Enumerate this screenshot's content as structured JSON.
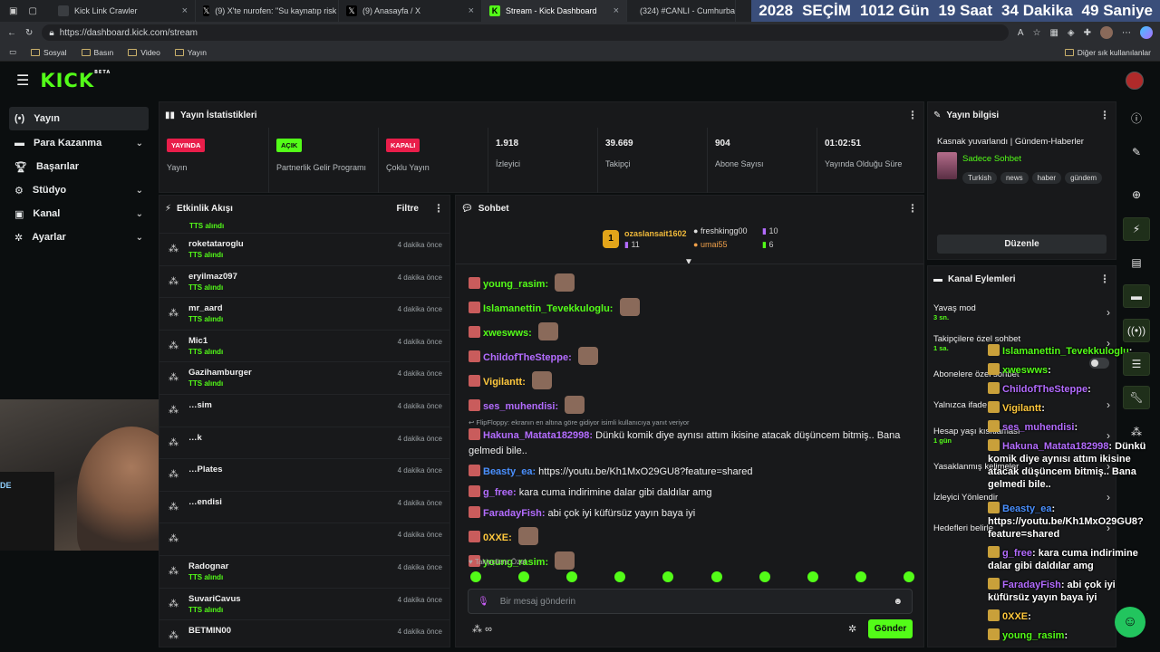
{
  "browser": {
    "tabs": [
      {
        "title": "Kick Link Crawler",
        "icon_color": "#3a3d41"
      },
      {
        "title": "(9) X'te nurofen: \"Su kaynatıp risk",
        "icon_color": "#000000"
      },
      {
        "title": "(9) Anasayfa / X",
        "icon_color": "#000000"
      },
      {
        "title": "Stream - Kick Dashboard",
        "icon_color": "#53fc18"
      },
      {
        "title": "(324) #CANLI - Cumhurbaşk",
        "icon_color": "#ff0000"
      }
    ],
    "url": "https://dashboard.kick.com/stream",
    "bookmarks": [
      "Sosyal",
      "Basın",
      "Video",
      "Yayın"
    ],
    "other_bookmarks": "Diğer sık kullanılanlar"
  },
  "countdown": {
    "year": "2028",
    "label": "SEÇİM",
    "days": "1012",
    "days_label": "Gün",
    "hours": "19",
    "hours_label": "Saat",
    "minutes": "34",
    "minutes_label": "Dakika",
    "seconds": "49",
    "seconds_label": "Saniye"
  },
  "brand": {
    "logo": "KICK",
    "beta": "BETA",
    "color": "#53fc18"
  },
  "sidebar": {
    "items": [
      {
        "label": "Yayın",
        "icon": "broadcast-icon",
        "active": true
      },
      {
        "label": "Para Kazanma",
        "icon": "money-icon"
      },
      {
        "label": "Başarılar",
        "icon": "trophy-icon"
      },
      {
        "label": "Stüdyo",
        "icon": "studio-icon"
      },
      {
        "label": "Kanal",
        "icon": "channel-icon"
      },
      {
        "label": "Ayarlar",
        "icon": "gear-icon"
      }
    ]
  },
  "stats": {
    "title": "Yayın İstatistikleri",
    "cards": [
      {
        "badge": "YAYINDA",
        "label": "Yayın",
        "badge_color": "#e91e4a"
      },
      {
        "badge": "AÇIK",
        "label": "Partnerlik Gelir Programı",
        "badge_color": "#53fc18"
      },
      {
        "badge": "KAPALI",
        "label": "Çoklu Yayın",
        "badge_color": "#e91e4a"
      },
      {
        "value": "1.918",
        "label": "İzleyici"
      },
      {
        "value": "39.669",
        "label": "Takipçi"
      },
      {
        "value": "904",
        "label": "Abone Sayısı"
      },
      {
        "value": "01:02:51",
        "label": "Yayında Olduğu Süre"
      }
    ]
  },
  "activity": {
    "title": "Etkinlik Akışı",
    "filter": "Filtre",
    "top_partial": "TTS alındı",
    "events": [
      {
        "name": "roketataroglu",
        "sub": "TTS alındı",
        "time": "4 dakika önce"
      },
      {
        "name": "eryilmaz097",
        "sub": "TTS alındı",
        "time": "4 dakika önce"
      },
      {
        "name": "mr_aard",
        "sub": "TTS alındı",
        "time": "4 dakika önce"
      },
      {
        "name": "Mic1",
        "sub": "TTS alındı",
        "time": "4 dakika önce"
      },
      {
        "name": "Gazihamburger",
        "sub": "TTS alındı",
        "time": "4 dakika önce"
      },
      {
        "name": "…sim",
        "sub": "",
        "time": "4 dakika önce"
      },
      {
        "name": "…k",
        "sub": "",
        "time": "4 dakika önce"
      },
      {
        "name": "…Plates",
        "sub": "",
        "time": "4 dakika önce"
      },
      {
        "name": "…endisi",
        "sub": "",
        "time": "4 dakika önce"
      },
      {
        "name": "",
        "sub": "",
        "time": "4 dakika önce"
      },
      {
        "name": "Radognar",
        "sub": "TTS alındı",
        "time": "4 dakika önce"
      },
      {
        "name": "SuvariCavus",
        "sub": "TTS alındı",
        "time": "4 dakika önce"
      },
      {
        "name": "BETMIN00",
        "sub": "",
        "time": "4 dakika önce"
      }
    ]
  },
  "chat": {
    "title": "Sohbet",
    "leaders": [
      {
        "rank": "1",
        "name": "ozaslansait1602",
        "count": "11"
      },
      {
        "name": "freshkingg00",
        "count": "10"
      },
      {
        "name": "umai55",
        "count": "6"
      }
    ],
    "messages": [
      {
        "user": "young_rasim",
        "color": "#53fc18",
        "text": ""
      },
      {
        "user": "Islamanettin_Tevekkuloglu",
        "color": "#53fc18",
        "text": ""
      },
      {
        "user": "xweswws",
        "color": "#53fc18",
        "text": ""
      },
      {
        "user": "ChildofTheSteppe",
        "color": "#b36cff",
        "text": ""
      },
      {
        "user": "Vigilantt",
        "color": "#ffc83d",
        "text": ""
      },
      {
        "user": "ses_muhendisi",
        "color": "#b36cff",
        "text": ""
      }
    ],
    "reply_note": "FlipFloppy: ekranın en altına göre gidiyor isimli kullanıcıya yanıt veriyor",
    "messages2": [
      {
        "user": "Hakuna_Matata182998",
        "color": "#b36cff",
        "text": "Dünkü komik diye aynısı attım ikisine atacak düşüncem bitmiş.. Bana gelmedi bile.."
      },
      {
        "user": "Beasty_ea",
        "color": "#4a90ff",
        "text": "https://youtu.be/Kh1MxO29GU8?feature=shared"
      },
      {
        "user": "g_free",
        "color": "#b36cff",
        "text": "kara cuma indirimine dalar gibi daldılar amg"
      },
      {
        "user": "FaradayFish",
        "color": "#b36cff",
        "text": "abi çok iyi küfürsüz yayın baya iyi"
      },
      {
        "user": "0XXE",
        "color": "#ffc83d",
        "text": ""
      },
      {
        "user": "young_rasim",
        "color": "#53fc18",
        "text": ""
      }
    ],
    "followers_only": "Takipçilere Özel",
    "input_placeholder": "Bir mesaj gönderin",
    "send": "Gönder"
  },
  "stream_info": {
    "title": "Yayın bilgisi",
    "stream_title": "Kasnak yuvarlandı | Gündem-Haberler",
    "category": "Sadece Sohbet",
    "tags": [
      "Turkish",
      "news",
      "haber",
      "gündem"
    ],
    "edit": "Düzenle"
  },
  "channel_actions": {
    "title": "Kanal Eylemleri",
    "items": [
      {
        "label": "Yavaş mod",
        "sub": "3 sn."
      },
      {
        "label": "Takipçilere özel sohbet",
        "sub": "1 sa."
      },
      {
        "label": "Abonelere özel sohbet",
        "sub": ""
      },
      {
        "label": "Yalnızca ifade…",
        "sub": ""
      },
      {
        "label": "Hesap yaşı kısıtlaması",
        "sub": "1 gün"
      },
      {
        "label": "Yasaklanmış kelimeler",
        "sub": ""
      },
      {
        "label": "İzleyici Yönlendir",
        "sub": ""
      },
      {
        "label": "Hedefleri belirle",
        "sub": ""
      }
    ]
  },
  "overlay_chat": [
    {
      "user": "Islamanettin_Tevekkuloglu",
      "color": "#53fc18",
      "text": ""
    },
    {
      "user": "xweswws",
      "color": "#53fc18",
      "text": ""
    },
    {
      "user": "ChildofTheSteppe",
      "color": "#b36cff",
      "text": ""
    },
    {
      "user": "Vigilantt",
      "color": "#ffc83d",
      "text": ""
    },
    {
      "user": "ses_muhendisi",
      "color": "#b36cff",
      "text": ""
    },
    {
      "user": "Hakuna_Matata182998",
      "color": "#b36cff",
      "text": "Dünkü komik diye aynısı attım ikisine atacak düşüncem bitmiş.. Bana gelmedi bile.."
    },
    {
      "user": "Beasty_ea",
      "color": "#4a90ff",
      "text": "https://youtu.be/Kh1MxO29GU8?feature=shared"
    },
    {
      "user": "g_free",
      "color": "#b36cff",
      "text": "kara cuma indirimine dalar gibi daldılar amg"
    },
    {
      "user": "FaradayFish",
      "color": "#b36cff",
      "text": "abi çok iyi küfürsüz yayın baya iyi"
    },
    {
      "user": "0XXE",
      "color": "#ffc83d",
      "text": ""
    },
    {
      "user": "young_rasim",
      "color": "#53fc18",
      "text": ""
    }
  ]
}
